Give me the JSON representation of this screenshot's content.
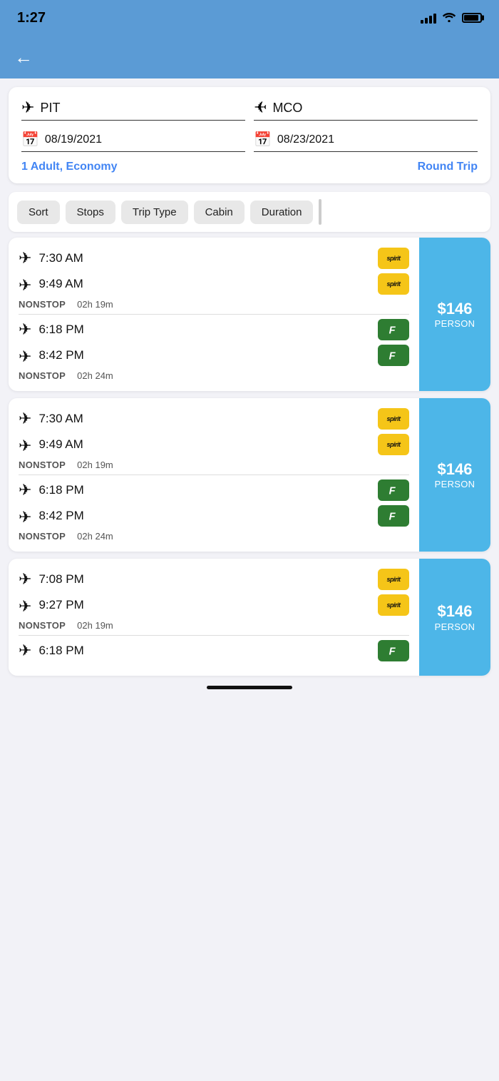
{
  "statusBar": {
    "time": "1:27"
  },
  "navBar": {
    "backLabel": "←"
  },
  "searchCard": {
    "fromAirport": "PIT",
    "toAirport": "MCO",
    "departDate": "08/19/2021",
    "returnDate": "08/23/2021",
    "passengers": "1 Adult,  Economy",
    "tripType": "Round Trip"
  },
  "filters": {
    "sort": "Sort",
    "stops": "Stops",
    "tripType": "Trip Type",
    "cabin": "Cabin",
    "duration": "Duration"
  },
  "flights": [
    {
      "id": "flight-1",
      "segments": [
        {
          "time": "7:30 AM",
          "airline": "spirit",
          "direction": "depart"
        },
        {
          "time": "9:49 AM",
          "airline": "spirit",
          "direction": "arrive"
        }
      ],
      "stop": "NONSTOP",
      "duration": "02h 19m",
      "segments2": [
        {
          "time": "6:18 PM",
          "airline": "frontier",
          "direction": "depart"
        },
        {
          "time": "8:42 PM",
          "airline": "frontier",
          "direction": "arrive"
        }
      ],
      "stop2": "NONSTOP",
      "duration2": "02h 24m",
      "price": "$146",
      "priceLabel": "PERSON"
    },
    {
      "id": "flight-2",
      "segments": [
        {
          "time": "7:30 AM",
          "airline": "spirit",
          "direction": "depart"
        },
        {
          "time": "9:49 AM",
          "airline": "spirit",
          "direction": "arrive"
        }
      ],
      "stop": "NONSTOP",
      "duration": "02h 19m",
      "segments2": [
        {
          "time": "6:18 PM",
          "airline": "frontier",
          "direction": "depart"
        },
        {
          "time": "8:42 PM",
          "airline": "frontier",
          "direction": "arrive"
        }
      ],
      "stop2": "NONSTOP",
      "duration2": "02h 24m",
      "price": "$146",
      "priceLabel": "PERSON"
    },
    {
      "id": "flight-3",
      "segments": [
        {
          "time": "7:08 PM",
          "airline": "spirit",
          "direction": "depart"
        },
        {
          "time": "9:27 PM",
          "airline": "spirit",
          "direction": "arrive"
        }
      ],
      "stop": "NONSTOP",
      "duration": "02h 19m",
      "segments2": [
        {
          "time": "6:18 PM",
          "airline": "frontier",
          "direction": "depart"
        }
      ],
      "stop2": "",
      "duration2": "",
      "price": "$146",
      "priceLabel": "PERSON"
    }
  ]
}
